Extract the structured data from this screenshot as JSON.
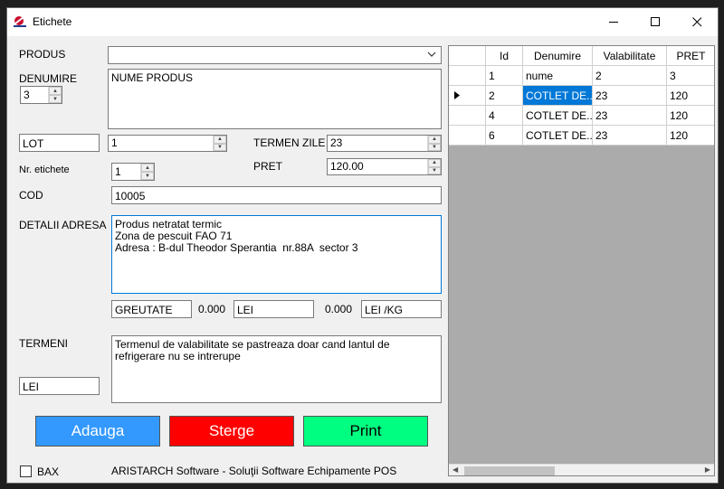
{
  "window": {
    "title": "Etichete",
    "minimize": "—",
    "maximize": "☐",
    "close": "✕"
  },
  "form": {
    "produs_label": "PRODUS",
    "produs_value": "",
    "denumire_label": "DENUMIRE",
    "denumire_count": "3",
    "denumire_text": "NUME PRODUS",
    "lot_box": "LOT",
    "lot_value": "1",
    "termen_label": "TERMEN ZILE",
    "termen_value": "23",
    "nr_etichete_label": "Nr. etichete",
    "nr_etichete_value": "1",
    "pret_label": "PRET",
    "pret_value": "120.00",
    "cod_label": "COD",
    "cod_value": "10005",
    "detalii_label": "DETALII ADRESA",
    "detalii_text": "Produs netratat termic\nZona de pescuit FAO 71\nAdresa : B-dul Theodor Sperantia  nr.88A  sector 3",
    "greutate_box": "GREUTATE",
    "greutate_value": "0.000",
    "lei_box": "LEI",
    "lei_value": "0.000",
    "leikg_box": "LEI /KG",
    "termeni_label": "TERMENI",
    "termeni_lei_box": "LEI",
    "termeni_text": "Termenul de valabilitate se pastreaza doar cand lantul de refrigerare nu se intrerupe"
  },
  "buttons": {
    "adauga": "Adauga",
    "sterge": "Sterge",
    "print": "Print"
  },
  "footer": {
    "bax_label": "BAX",
    "credits": "ARISTARCH Software - Soluţii Software  Echipamente POS"
  },
  "grid": {
    "columns": [
      "Id",
      "Denumire",
      "Valabilitate",
      "PRET"
    ],
    "rows": [
      {
        "id": "1",
        "denumire": "nume",
        "valabilitate": "2",
        "pret": "3"
      },
      {
        "id": "2",
        "denumire": "COTLET DE...",
        "valabilitate": "23",
        "pret": "120"
      },
      {
        "id": "4",
        "denumire": "COTLET DE...",
        "valabilitate": "23",
        "pret": "120"
      },
      {
        "id": "6",
        "denumire": "COTLET DE...",
        "valabilitate": "23",
        "pret": "120"
      }
    ]
  },
  "colors": {
    "adauga": "#3399ff",
    "sterge": "#ff0000",
    "print": "#00ff80",
    "selection": "#0078d7",
    "grid_background": "#ababab"
  },
  "icons": {
    "app": "aristarch-logo-icon",
    "row_pointer": "current-row-arrow-icon",
    "dropdown": "chevron-down-icon"
  }
}
